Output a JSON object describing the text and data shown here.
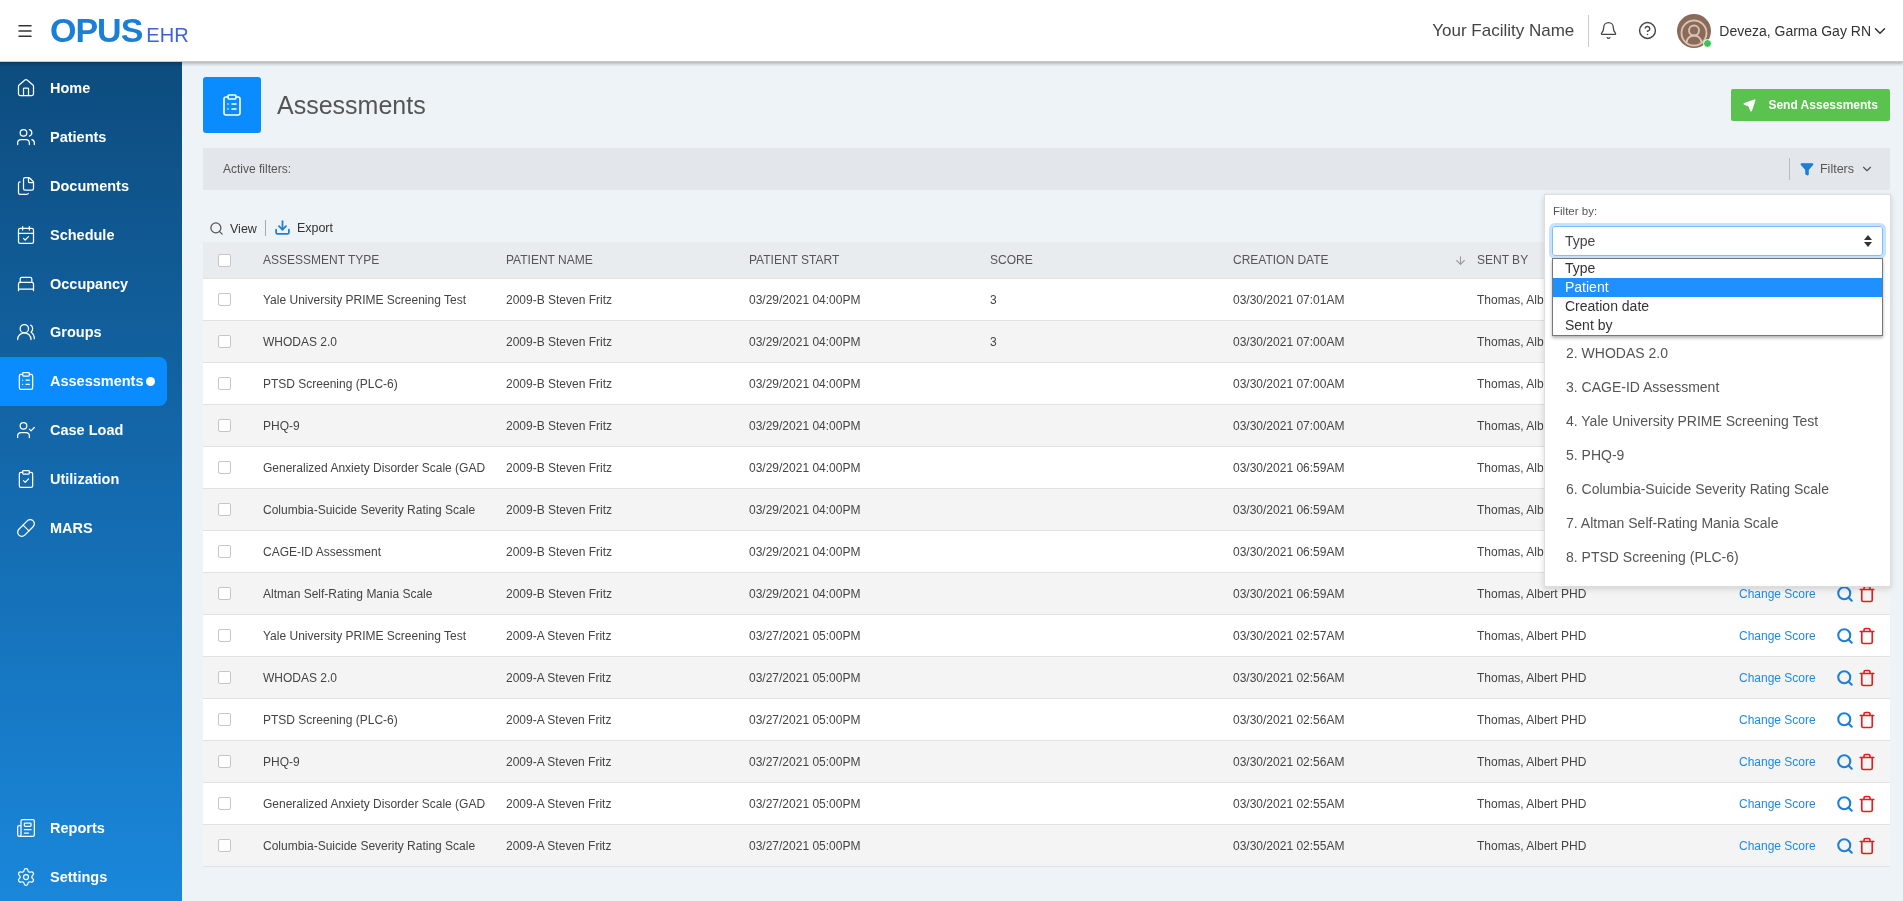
{
  "header": {
    "logo": "OPUS",
    "logo_suffix": "EHR",
    "facility": "Your Facility Name",
    "user": "Deveza, Garma Gay RN",
    "user_online": true
  },
  "sidebar": {
    "items": [
      {
        "label": "Home",
        "selected": false,
        "badge": false
      },
      {
        "label": "Patients",
        "selected": false,
        "badge": false
      },
      {
        "label": "Documents",
        "selected": false,
        "badge": false
      },
      {
        "label": "Schedule",
        "selected": false,
        "badge": false
      },
      {
        "label": "Occupancy",
        "selected": false,
        "badge": false
      },
      {
        "label": "Groups",
        "selected": false,
        "badge": false
      },
      {
        "label": "Assessments",
        "selected": true,
        "badge": true
      },
      {
        "label": "Case Load",
        "selected": false,
        "badge": false
      },
      {
        "label": "Utilization",
        "selected": false,
        "badge": false
      },
      {
        "label": "MARS",
        "selected": false,
        "badge": false
      }
    ],
    "bottom_items": [
      {
        "label": "Reports",
        "selected": false,
        "badge": false
      },
      {
        "label": "Settings",
        "selected": false,
        "badge": false
      }
    ]
  },
  "page": {
    "title": "Assessments",
    "send_button": "Send Assessments"
  },
  "filters": {
    "label": "Active filters:",
    "button": "Filters"
  },
  "toolbar": {
    "view": "View",
    "export": "Export"
  },
  "table": {
    "all_checked": false,
    "columns": [
      {
        "label": "ASSESSMENT TYPE",
        "sorted": false
      },
      {
        "label": "PATIENT NAME",
        "sorted": false
      },
      {
        "label": "PATIENT START",
        "sorted": false
      },
      {
        "label": "SCORE",
        "sorted": false
      },
      {
        "label": "CREATION DATE",
        "sorted": true
      },
      {
        "label": "SENT BY",
        "sorted": false
      }
    ],
    "rows": [
      {
        "checked": false,
        "cells": [
          "Yale University PRIME Screening Test",
          "2009-B Steven Fritz",
          "03/29/2021 04:00PM",
          "3",
          "03/30/2021 07:01AM",
          "Thomas, Alb"
        ]
      },
      {
        "checked": false,
        "cells": [
          "WHODAS 2.0",
          "2009-B Steven Fritz",
          "03/29/2021 04:00PM",
          "3",
          "03/30/2021 07:00AM",
          "Thomas, Alb"
        ]
      },
      {
        "checked": false,
        "cells": [
          "PTSD Screening (PLC-6)",
          "2009-B Steven Fritz",
          "03/29/2021 04:00PM",
          "",
          "03/30/2021 07:00AM",
          "Thomas, Alb"
        ]
      },
      {
        "checked": false,
        "cells": [
          "PHQ-9",
          "2009-B Steven Fritz",
          "03/29/2021 04:00PM",
          "",
          "03/30/2021 07:00AM",
          "Thomas, Alb"
        ]
      },
      {
        "checked": false,
        "cells": [
          "Generalized Anxiety Disorder Scale (GAD",
          "2009-B Steven Fritz",
          "03/29/2021 04:00PM",
          "",
          "03/30/2021 06:59AM",
          "Thomas, Alb"
        ]
      },
      {
        "checked": false,
        "cells": [
          "Columbia-Suicide Severity Rating Scale",
          "2009-B Steven Fritz",
          "03/29/2021 04:00PM",
          "",
          "03/30/2021 06:59AM",
          "Thomas, Alb"
        ]
      },
      {
        "checked": false,
        "cells": [
          "CAGE-ID Assessment",
          "2009-B Steven Fritz",
          "03/29/2021 04:00PM",
          "",
          "03/30/2021 06:59AM",
          "Thomas, Alb"
        ]
      },
      {
        "checked": false,
        "cells": [
          "Altman Self-Rating Mania Scale",
          "2009-B Steven Fritz",
          "03/29/2021 04:00PM",
          "",
          "03/30/2021 06:59AM",
          "Thomas, Albert PHD"
        ],
        "action": "Change Score"
      },
      {
        "checked": false,
        "cells": [
          "Yale University PRIME Screening Test",
          "2009-A Steven Fritz",
          "03/27/2021 05:00PM",
          "",
          "03/30/2021 02:57AM",
          "Thomas, Albert PHD"
        ],
        "action": "Change Score"
      },
      {
        "checked": false,
        "cells": [
          "WHODAS 2.0",
          "2009-A Steven Fritz",
          "03/27/2021 05:00PM",
          "",
          "03/30/2021 02:56AM",
          "Thomas, Albert PHD"
        ],
        "action": "Change Score"
      },
      {
        "checked": false,
        "cells": [
          "PTSD Screening (PLC-6)",
          "2009-A Steven Fritz",
          "03/27/2021 05:00PM",
          "",
          "03/30/2021 02:56AM",
          "Thomas, Albert PHD"
        ],
        "action": "Change Score"
      },
      {
        "checked": false,
        "cells": [
          "PHQ-9",
          "2009-A Steven Fritz",
          "03/27/2021 05:00PM",
          "",
          "03/30/2021 02:56AM",
          "Thomas, Albert PHD"
        ],
        "action": "Change Score"
      },
      {
        "checked": false,
        "cells": [
          "Generalized Anxiety Disorder Scale (GAD",
          "2009-A Steven Fritz",
          "03/27/2021 05:00PM",
          "",
          "03/30/2021 02:55AM",
          "Thomas, Albert PHD"
        ],
        "action": "Change Score"
      },
      {
        "checked": false,
        "cells": [
          "Columbia-Suicide Severity Rating Scale",
          "2009-A Steven Fritz",
          "03/27/2021 05:00PM",
          "",
          "03/30/2021 02:55AM",
          "Thomas, Albert PHD"
        ],
        "action": "Change Score"
      }
    ]
  },
  "filter_panel": {
    "label": "Filter by:",
    "select_value": "Type",
    "options": [
      {
        "label": "Type",
        "selected": false
      },
      {
        "label": "Patient",
        "selected": true
      },
      {
        "label": "Creation date",
        "selected": false
      },
      {
        "label": "Sent by",
        "selected": false
      }
    ],
    "items": [
      "2. WHODAS 2.0",
      "3. CAGE-ID Assessment",
      "4. Yale University PRIME Screening Test",
      "5. PHQ-9",
      "6. Columbia-Suicide Severity Rating Scale",
      "7. Altman Self-Rating Mania Scale",
      "8. PTSD Screening (PLC-6)"
    ]
  }
}
